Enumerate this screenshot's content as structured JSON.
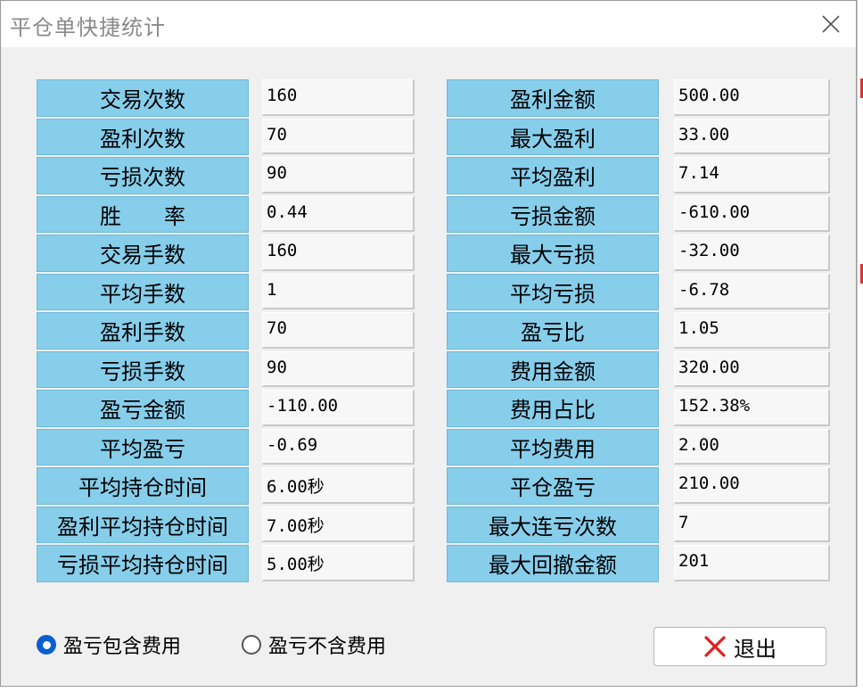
{
  "window": {
    "title": "平仓单快捷统计"
  },
  "left_stats": [
    {
      "label": "交易次数",
      "value": "160"
    },
    {
      "label": "盈利次数",
      "value": "70"
    },
    {
      "label": "亏损次数",
      "value": "90"
    },
    {
      "label": "胜　　率",
      "value": "0.44"
    },
    {
      "label": "交易手数",
      "value": "160"
    },
    {
      "label": "平均手数",
      "value": "1"
    },
    {
      "label": "盈利手数",
      "value": "70"
    },
    {
      "label": "亏损手数",
      "value": "90"
    },
    {
      "label": "盈亏金额",
      "value": "-110.00"
    },
    {
      "label": "平均盈亏",
      "value": "-0.69"
    },
    {
      "label": "平均持仓时间",
      "value": "6.00秒"
    },
    {
      "label": "盈利平均持仓时间",
      "value": "7.00秒"
    },
    {
      "label": "亏损平均持仓时间",
      "value": "5.00秒"
    }
  ],
  "right_stats": [
    {
      "label": "盈利金额",
      "value": "500.00"
    },
    {
      "label": "最大盈利",
      "value": "33.00"
    },
    {
      "label": "平均盈利",
      "value": "7.14"
    },
    {
      "label": "亏损金额",
      "value": "-610.00"
    },
    {
      "label": "最大亏损",
      "value": "-32.00"
    },
    {
      "label": "平均亏损",
      "value": "-6.78"
    },
    {
      "label": "盈亏比",
      "value": "1.05"
    },
    {
      "label": "费用金额",
      "value": "320.00"
    },
    {
      "label": "费用占比",
      "value": "152.38%"
    },
    {
      "label": "平均费用",
      "value": "2.00"
    },
    {
      "label": "平仓盈亏",
      "value": "210.00"
    },
    {
      "label": "最大连亏次数",
      "value": "7"
    },
    {
      "label": "最大回撤金额",
      "value": "201"
    }
  ],
  "options": {
    "include_fee": {
      "label": "盈亏包含费用",
      "checked": true
    },
    "exclude_fee": {
      "label": "盈亏不含费用",
      "checked": false
    }
  },
  "exit_button": {
    "label": "退出",
    "icon": "red-x-icon"
  },
  "colors": {
    "label_bg": "#87ceeb",
    "radio_checked": "#0a5fcf",
    "exit_icon": "#e02020"
  }
}
